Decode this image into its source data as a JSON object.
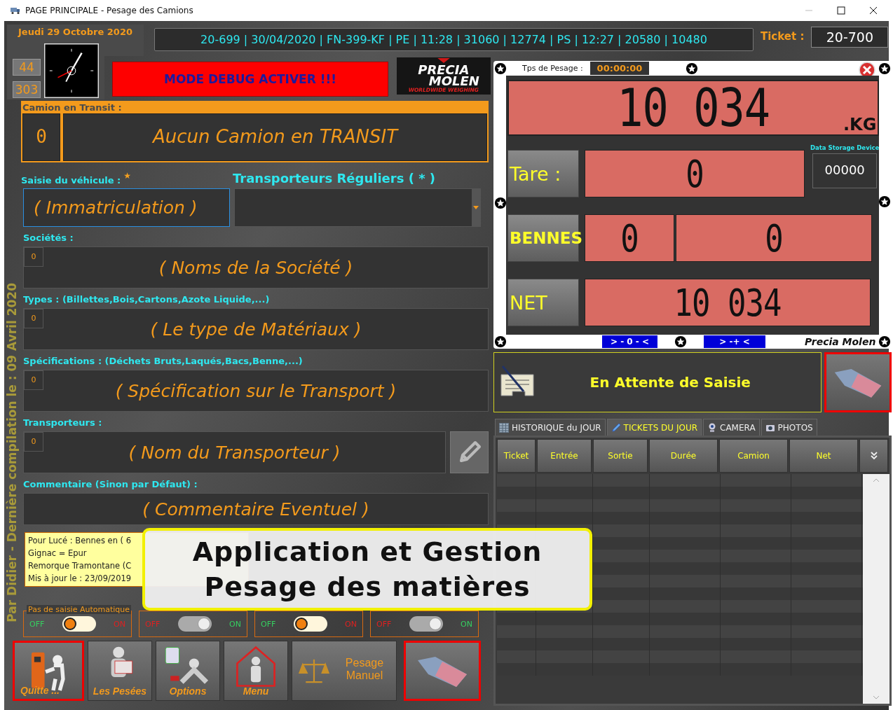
{
  "window": {
    "title": "PAGE PRINCIPALE - Pesage des Camions"
  },
  "header": {
    "date": "Jeudi 29 Octobre 2020",
    "counters": [
      "44",
      "303"
    ],
    "ticker": "20-699 | 30/04/2020 | FN-399-KF | PE | 11:28 | 31060 | 12774 | PS | 12:27 | 20580 | 10480",
    "ticket_label": "Ticket :",
    "ticket_value": "20-700",
    "debug_banner": "MODE DEBUG ACTIVER !!!",
    "logo": {
      "line_1": "PRECIA",
      "line_2": "MOLEN",
      "tagline": "WORLDWIDE WEIGHING"
    }
  },
  "side_caption": "Par Didier - Dernière compilation le : 09 Avril 2020",
  "transit": {
    "label": "Camion en Transit :",
    "count": "0",
    "message": "Aucun Camion en TRANSIT"
  },
  "vehicle": {
    "label": "Saisie du véhicule :",
    "required_mark": "★",
    "placeholder": "( Immatriculation )"
  },
  "regular_carriers": {
    "label": "Transporteurs Réguliers ( * )"
  },
  "fields": [
    {
      "label": "Sociétés :",
      "count": "0",
      "placeholder": "( Noms de la Société )",
      "has_button": false
    },
    {
      "label": "Types : (Billettes,Bois,Cartons,Azote Liquide,...)",
      "count": "0",
      "placeholder": "( Le type de Matériaux )",
      "has_button": false
    },
    {
      "label": "Spécifications : (Déchets Bruts,Laqués,Bacs,Benne,...)",
      "count": "0",
      "placeholder": "( Spécification sur le Transport )",
      "has_button": false
    },
    {
      "label": "Transporteurs :",
      "count": "0",
      "placeholder": "( Nom du Transporteur )",
      "has_button": true
    }
  ],
  "comment": {
    "label": "Commentaire (Sinon par Défaut) :",
    "placeholder": "( Commentaire Eventuel )"
  },
  "note": {
    "lines": [
      "Pour Lucé : Bennes en  ( 6",
      "Gignac = Epur",
      "Remorque Tramontane (C",
      "Mis à jour le : 23/09/2019"
    ]
  },
  "toggles": [
    {
      "label": "Pas de saisie Automatique",
      "off_text": "OFF",
      "on_text": "ON",
      "on": false
    },
    {
      "off_text": "OFF",
      "on_text": "ON",
      "on": true
    },
    {
      "off_text": "OFF",
      "on_text": "ON",
      "on": false
    },
    {
      "off_text": "OFF",
      "on_text": "ON",
      "on": true
    }
  ],
  "buttons": [
    {
      "kind": "exit",
      "label": "Quitte ..."
    },
    {
      "kind": "weighings",
      "label": "Les Pesées"
    },
    {
      "kind": "options",
      "label": "Options"
    },
    {
      "kind": "menu",
      "label": "Menu"
    },
    {
      "kind": "manual",
      "label": "Pesage Manuel"
    },
    {
      "kind": "eraser"
    }
  ],
  "scale": {
    "timer_label": "Tps de Pesage :",
    "timer": "00:00:00",
    "weight": "10 034",
    "unit": ".KG",
    "tare_label": "Tare :",
    "tare": "0",
    "storage_label": "Data Storage Device",
    "storage": "00000",
    "bins_label": "BENNES",
    "bins": [
      "0",
      "0"
    ],
    "net_label": "NET",
    "net": "10 034",
    "zero_button": "> - 0 - <",
    "tare_button": "> -+ <",
    "brand": "Precia Molen"
  },
  "status": {
    "message": "En Attente de Saisie"
  },
  "tabs": [
    {
      "kind": "table",
      "label": "HISTORIQUE du JOUR",
      "selected": false
    },
    {
      "kind": "pencil",
      "label": "TICKETS DU JOUR",
      "selected": true
    },
    {
      "kind": "camera",
      "label": "CAMERA",
      "selected": false
    },
    {
      "kind": "photos",
      "label": "PHOTOS",
      "selected": false
    }
  ],
  "table": {
    "columns": [
      "Ticket",
      "Entrée",
      "Sortie",
      "Durée",
      "Camion",
      "Net"
    ]
  },
  "callout": {
    "lines": [
      "Application et Gestion",
      "Pesage des matières"
    ]
  }
}
